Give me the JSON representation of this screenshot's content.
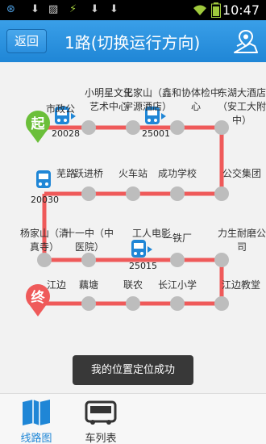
{
  "status_bar": {
    "time": "10:47",
    "icons": [
      "app-notification-icon",
      "download-icon",
      "image-icon",
      "sync-icon",
      "download-icon",
      "download-icon",
      "wifi-icon",
      "battery-icon"
    ]
  },
  "header": {
    "back_label": "返回",
    "title": "1路(切换运行方向)",
    "map_icon": "map-pin-icon"
  },
  "route": {
    "start_badge": "起",
    "end_badge": "终",
    "line_color": "#ef5a5a",
    "stop_color": "#bdbdbd",
    "row1": [
      {
        "name": "市政公"
      },
      {
        "name": "小明星文化艺术中心"
      },
      {
        "name": "王家山（鑫宇源酒店）"
      },
      {
        "name": "和协体检中心"
      },
      {
        "name": "东湖大酒店（安工大附中）"
      }
    ],
    "row2": [
      {
        "name": "芜路"
      },
      {
        "name": "跃进桥"
      },
      {
        "name": "火车站"
      },
      {
        "name": "成功学校"
      },
      {
        "name": "公交集团"
      }
    ],
    "row3": [
      {
        "name": "杨家山（清真寺）"
      },
      {
        "name": "十一中（中医院）"
      },
      {
        "name": "工人电影"
      },
      {
        "name": "一铁厂"
      },
      {
        "name": "力生耐磨公司"
      }
    ],
    "row4": [
      {
        "name": "江边"
      },
      {
        "name": "藕塘"
      },
      {
        "name": "联农"
      },
      {
        "name": "长江小学"
      },
      {
        "name": "江边教堂"
      }
    ],
    "buses": [
      {
        "id": "20028"
      },
      {
        "id": "25001"
      },
      {
        "id": "20030"
      },
      {
        "id": "25015"
      }
    ]
  },
  "toast": "我的位置定位成功",
  "tabs": [
    {
      "label": "线路图",
      "icon": "map-book-icon",
      "active": true,
      "color": "#1f86d6"
    },
    {
      "label": "车列表",
      "icon": "bus-icon",
      "active": false,
      "color": "#333333"
    }
  ]
}
